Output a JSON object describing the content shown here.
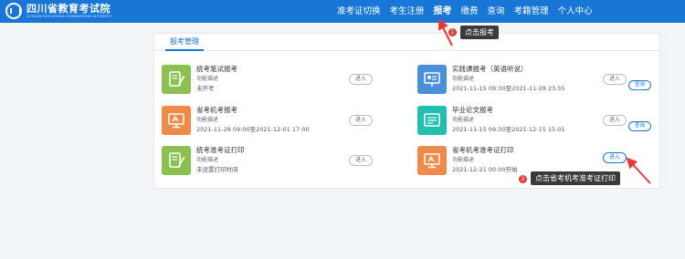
{
  "header": {
    "logo_cn": "四川省教育考试院",
    "logo_en": "SICHUAN EDUCATIONAL EXAMINATIONS AUTHORITY",
    "nav": [
      "准考证切换",
      "考生注册",
      "报考",
      "缴费",
      "查询",
      "考籍管理",
      "个人中心"
    ],
    "active_nav": "报考"
  },
  "callouts": [
    {
      "num": "1",
      "text": "点击报考"
    },
    {
      "num": "2",
      "text": "点击省考机考准考证打印"
    }
  ],
  "panel": {
    "tab": "报考管理",
    "cards": [
      {
        "title": "统考笔试报考",
        "desc": "功能描述",
        "extra": "未开考",
        "enter": "进入",
        "icon": "pencil-notebook-icon",
        "color": "#8cc152"
      },
      {
        "title": "实践课报考（英语听说）",
        "desc": "功能描述",
        "extra": "2021-11-15 09:30至2021-11-28 23:55",
        "enter": "进入",
        "query": "查询",
        "icon": "presentation-board-icon",
        "color": "#4a90d9"
      },
      {
        "title": "省考机考报考",
        "desc": "功能描述",
        "extra": "2021-11-29 09:00至2021-12-01 17:00",
        "enter": "进入",
        "icon": "computer-exam-icon",
        "color": "#f08a4b"
      },
      {
        "title": "毕业论文报考",
        "desc": "功能描述",
        "extra": "2021-11-15 09:30至2021-12-15 15:01",
        "enter": "进入",
        "query": "查询",
        "icon": "thesis-document-icon",
        "color": "#22bfb1"
      },
      {
        "title": "统考准考证打印",
        "desc": "功能描述",
        "extra": "未设置打印时间",
        "enter": "进入",
        "icon": "pencil-notebook-icon",
        "color": "#8cc152"
      },
      {
        "title": "省考机考准考证打印",
        "desc": "功能描述",
        "extra": "2021-12-21 00:00开始",
        "enter": "进入",
        "icon": "computer-exam-icon",
        "color": "#f08a4b"
      }
    ]
  }
}
